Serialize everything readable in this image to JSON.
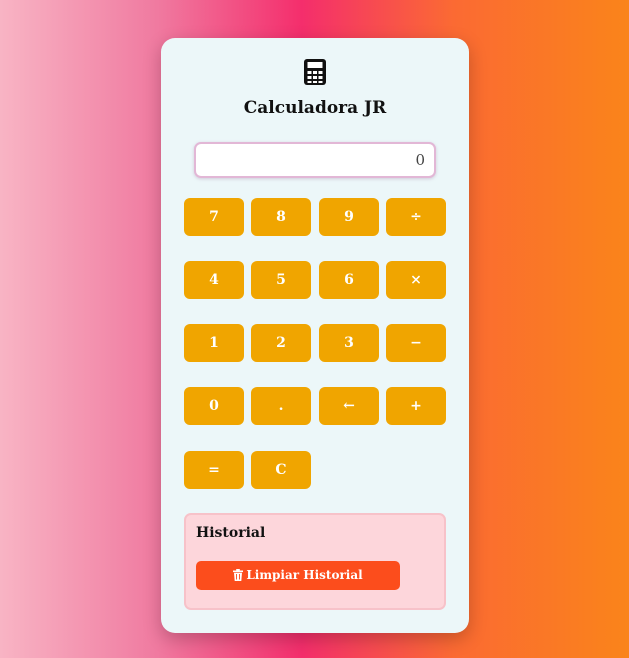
{
  "app": {
    "title": "Calculadora JR"
  },
  "display": {
    "value": "0"
  },
  "keys": {
    "k7": "7",
    "k8": "8",
    "k9": "9",
    "div": "÷",
    "k4": "4",
    "k5": "5",
    "k6": "6",
    "mul": "×",
    "k1": "1",
    "k2": "2",
    "k3": "3",
    "sub": "−",
    "k0": "0",
    "dot": ".",
    "back": "←",
    "add": "+",
    "eq": "=",
    "clear": "C"
  },
  "history": {
    "title": "Historial",
    "clear_label": "Limpiar Historial"
  },
  "colors": {
    "accent": "#f0a500",
    "danger": "#fc4d1c",
    "card": "#ecf7f9"
  },
  "icons": {
    "logo": "calculator-icon",
    "clear": "trash-icon"
  }
}
